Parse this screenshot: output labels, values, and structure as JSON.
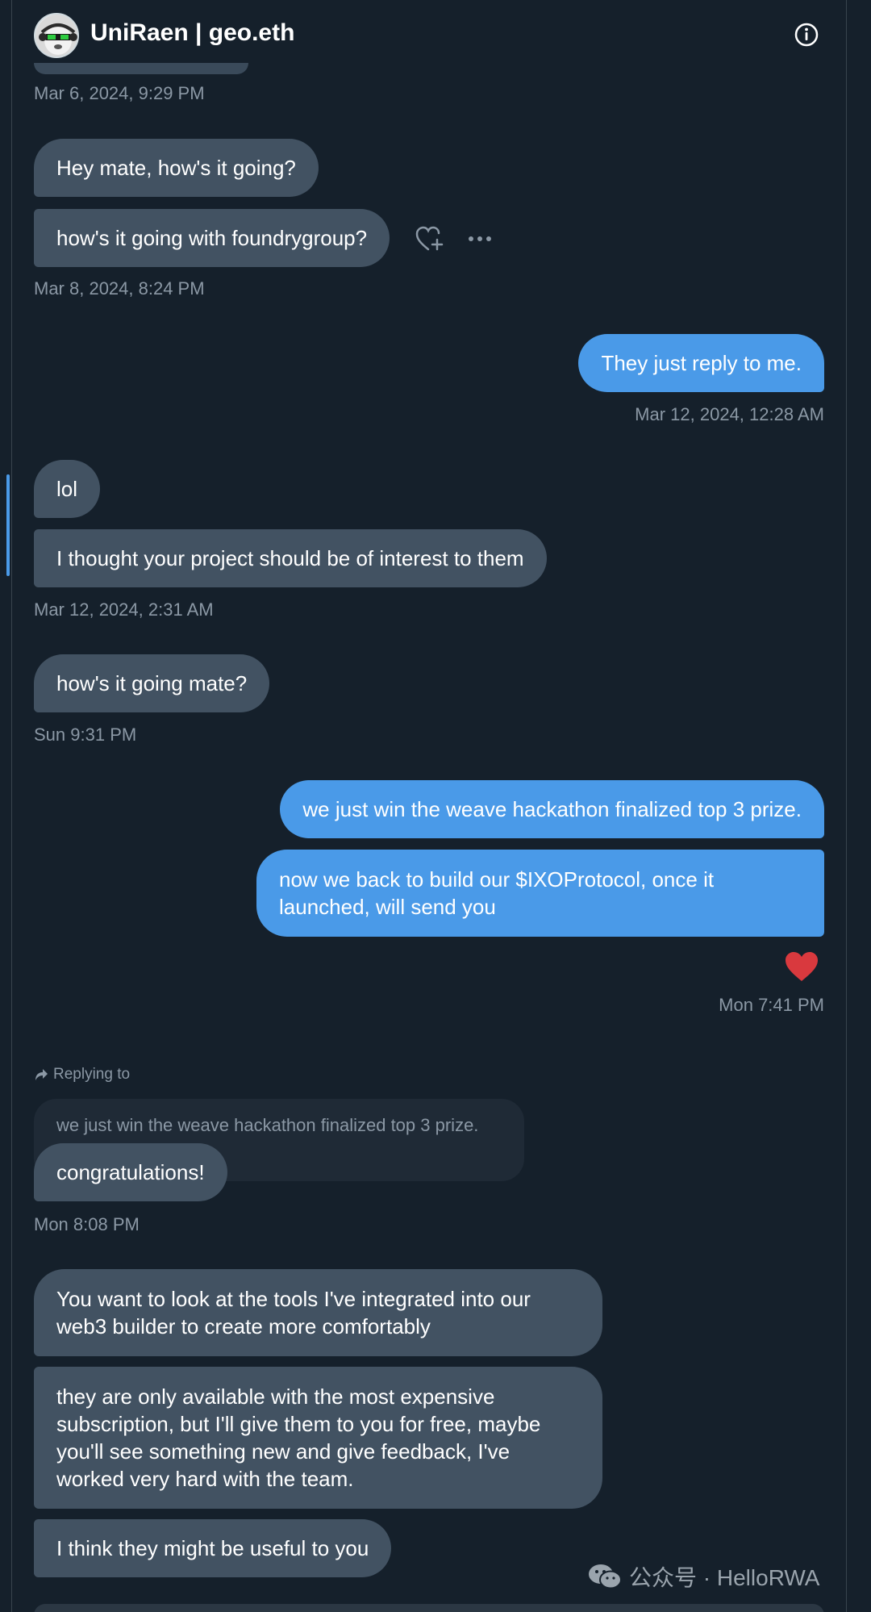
{
  "header": {
    "title": "UniRaen | geo.eth",
    "info_icon": "info-icon"
  },
  "messages": [
    {
      "id": "ts1",
      "text": "Mar 6, 2024, 9:29 PM"
    },
    {
      "id": "m1",
      "text": "Hey mate, how's it going?"
    },
    {
      "id": "m2",
      "text": "how's it going with foundrygroup?"
    },
    {
      "id": "ts2",
      "text": "Mar 8, 2024, 8:24 PM"
    },
    {
      "id": "m3",
      "text": "They just reply to me."
    },
    {
      "id": "ts3",
      "text": "Mar 12, 2024, 12:28 AM"
    },
    {
      "id": "m4",
      "text": "lol"
    },
    {
      "id": "m5",
      "text": "I thought your project should be of interest to them"
    },
    {
      "id": "ts4",
      "text": "Mar 12, 2024, 2:31 AM"
    },
    {
      "id": "m6",
      "text": "how's it going mate?"
    },
    {
      "id": "ts5",
      "text": "Sun 9:31 PM"
    },
    {
      "id": "m7",
      "text": "we just win the weave hackathon finalized top 3 prize."
    },
    {
      "id": "m8",
      "text": "now we back to build our $IXOProtocol, once it launched, will send you"
    },
    {
      "id": "ts6",
      "text": "Mon 7:41 PM"
    },
    {
      "id": "reply_label",
      "text": "Replying to"
    },
    {
      "id": "quoted",
      "text": "we just win the weave hackathon finalized top 3 prize."
    },
    {
      "id": "m9",
      "text": "congratulations!"
    },
    {
      "id": "ts7",
      "text": "Mon 8:08 PM"
    },
    {
      "id": "m10",
      "text": "You want to look at the tools I've integrated into our web3 builder to create more comfortably"
    },
    {
      "id": "m11",
      "text": "they are only available with the most expensive subscription, but I'll give them to you for free, maybe you'll see something new and give feedback, I've worked very hard with the team."
    },
    {
      "id": "m12",
      "text": "I think they might be useful to you"
    }
  ],
  "reaction": {
    "icon": "heart-icon",
    "color": "#d9393e"
  },
  "actions": {
    "react_icon": "heart-plus-icon",
    "more_icon": "more-icon"
  },
  "watermark": {
    "text": "公众号 · HelloRWA",
    "icon": "wechat-icon"
  },
  "colors": {
    "background": "#15202b",
    "incoming_bubble": "#425262",
    "outgoing_bubble": "#4a9ae8",
    "timestamp": "#8b98a5"
  }
}
